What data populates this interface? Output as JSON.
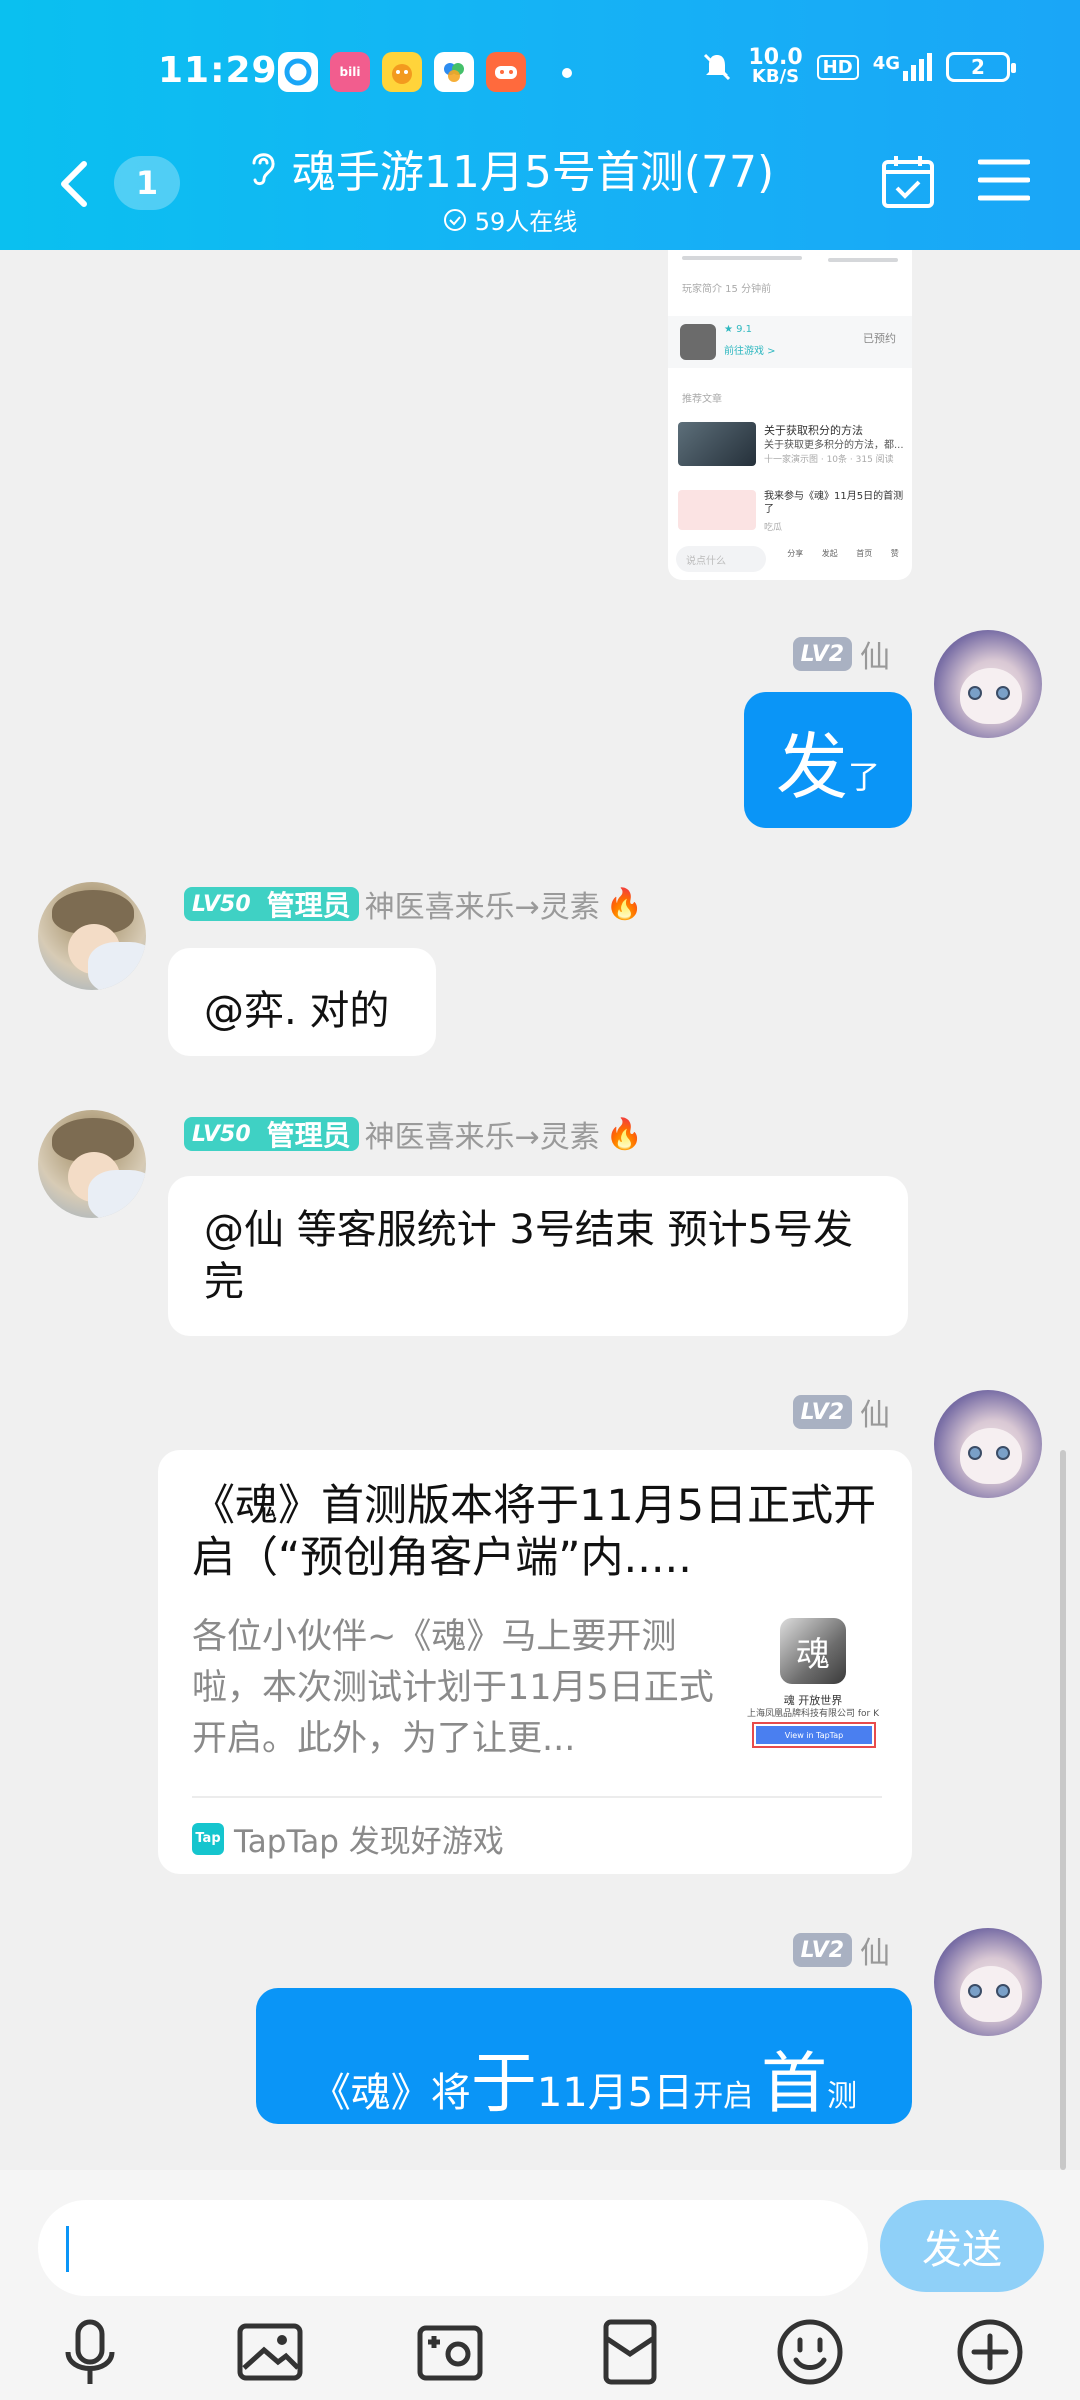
{
  "status_bar": {
    "time": "11:29",
    "net_speed_value": "10.0",
    "net_speed_unit": "KB/S",
    "hd": "HD",
    "network": "4G",
    "battery": "2",
    "app_icons": [
      "qq-browser-icon",
      "bilibili-icon",
      "cat-app-icon",
      "baidu-netdisk-icon",
      "game-center-icon"
    ]
  },
  "header": {
    "unread_count": "1",
    "title": "魂手游11月5号首测(77)",
    "online": "59人在线"
  },
  "screenshot_preview": {
    "section1": "玩家简介 15 分钟前",
    "app_rating": "★ 9.1",
    "app_status": "已预约",
    "app_follow": "前往游戏 >",
    "section2": "推荐文章",
    "article1_title": "关于获取积分的方法",
    "article1_sub": "关于获取更多积分的方法，都...",
    "article1_meta": "十一家演示图 · 10条 · 315 阅读",
    "article2_title": "我来参与《魂》11月5日的首测了",
    "article2_meta": "吃瓜",
    "input_placeholder": "说点什么",
    "actions": [
      "分享",
      "发起",
      "首页",
      "赞"
    ]
  },
  "messages": [
    {
      "sender": "仙",
      "level": "LV2",
      "big": "发",
      "small": "了"
    },
    {
      "sender": "神医喜来乐→灵素",
      "level": "LV50",
      "role": "管理员",
      "text": "@弈. 对的"
    },
    {
      "sender": "神医喜来乐→灵素",
      "level": "LV50",
      "role": "管理员",
      "text": "@仙 等客服统计 3号结束 预计5号发完"
    },
    {
      "sender": "仙",
      "level": "LV2"
    },
    {
      "sender": "仙",
      "level": "LV2",
      "p1": "《魂》将",
      "p2": "于",
      "p3": "11月5日",
      "p4": "开启",
      "p5": "首",
      "p6": "测"
    }
  ],
  "link_card": {
    "title": "《魂》首测版本将于11月5日正式开启（“预创角客户端”内.....",
    "desc": "各位小伙伴~《魂》马上要开测啦，本次测试计划于11月5日正式开启。此外，为了让更...",
    "thumb_caption": "魂 开放世界",
    "thumb_company": "上海凤凰品牌科技有限公司 for K",
    "thumb_button": "View in TapTap",
    "source_icon": "Tap",
    "source": "TapTap 发现好游戏"
  },
  "composer": {
    "placeholder": "",
    "send": "发送",
    "tools": [
      "microphone-icon",
      "image-icon",
      "camera-icon",
      "red-packet-icon",
      "emoji-icon",
      "plus-icon"
    ]
  },
  "colors": {
    "header_start": "#0ac0f0",
    "header_end": "#1aa6f7",
    "bubble_blue": "#0a95f7",
    "admin_teal": "#3fd1c4",
    "send_button": "#8fd0f8"
  }
}
